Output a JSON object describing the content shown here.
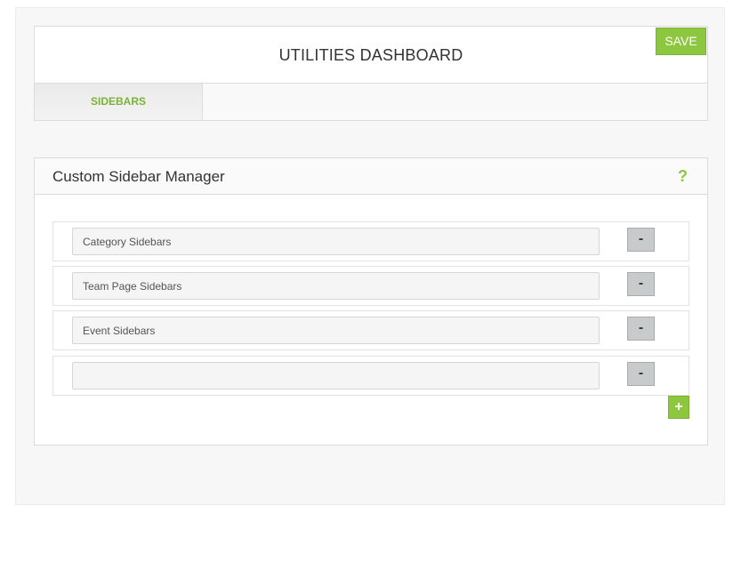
{
  "header": {
    "title": "UTILITIES DASHBOARD",
    "save_label": "SAVE"
  },
  "tabs": [
    {
      "label": "SIDEBARS",
      "active": true
    }
  ],
  "manager": {
    "title": "Custom Sidebar Manager",
    "help_glyph": "?",
    "remove_glyph": "-",
    "add_glyph": "+",
    "sidebars": [
      {
        "value": "Category Sidebars"
      },
      {
        "value": "Team Page Sidebars"
      },
      {
        "value": "Event Sidebars"
      },
      {
        "value": ""
      }
    ]
  },
  "colors": {
    "accent": "#8dc63f",
    "button_gray": "#c8cbcc"
  }
}
